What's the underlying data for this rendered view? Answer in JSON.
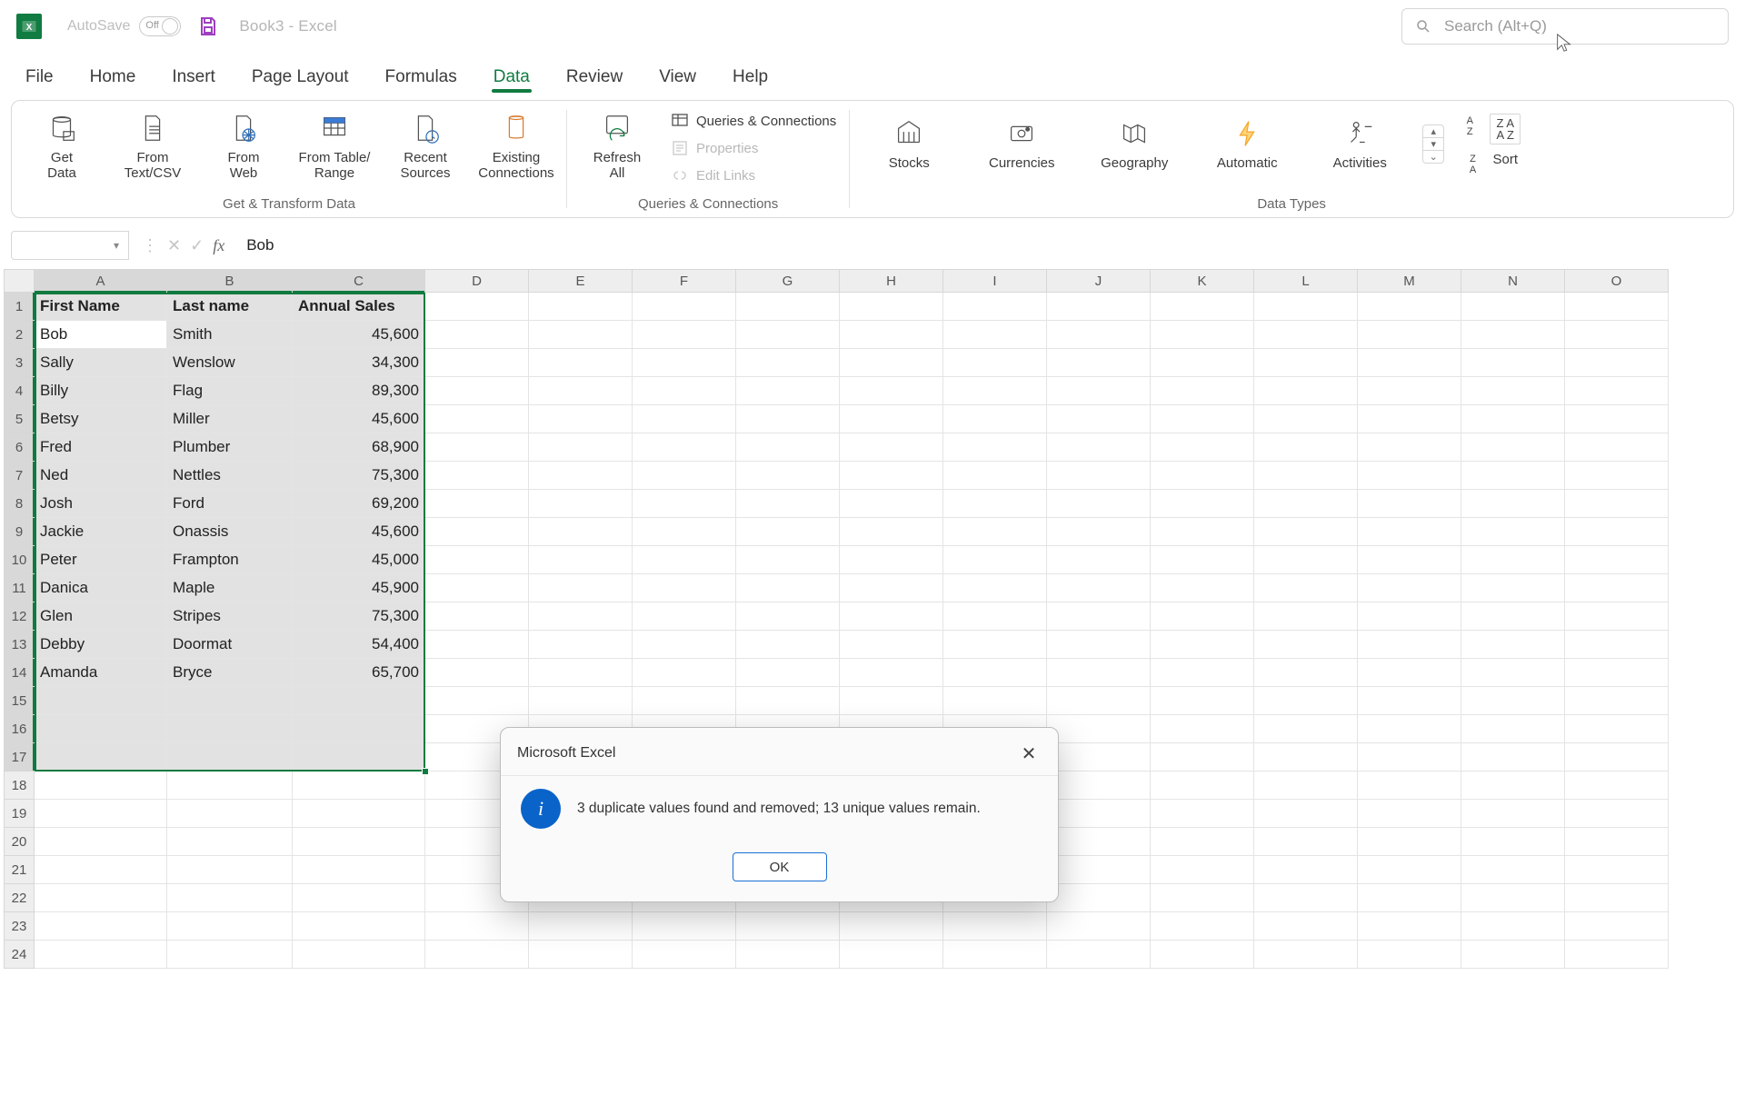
{
  "titlebar": {
    "autosave_label": "AutoSave",
    "autosave_state": "Off",
    "doc_title": "Book3  -  Excel",
    "search_placeholder": "Search (Alt+Q)"
  },
  "tabs": [
    "File",
    "Home",
    "Insert",
    "Page Layout",
    "Formulas",
    "Data",
    "Review",
    "View",
    "Help"
  ],
  "active_tab": "Data",
  "ribbon": {
    "group1": {
      "label": "Get & Transform Data",
      "buttons": [
        "Get\nData",
        "From\nText/CSV",
        "From\nWeb",
        "From Table/\nRange",
        "Recent\nSources",
        "Existing\nConnections"
      ]
    },
    "group2": {
      "label": "Queries & Connections",
      "refresh": "Refresh\nAll",
      "items": [
        "Queries & Connections",
        "Properties",
        "Edit Links"
      ]
    },
    "group3": {
      "label": "Data Types",
      "types": [
        "Stocks",
        "Currencies",
        "Geography",
        "Automatic",
        "Activities"
      ]
    },
    "group4": {
      "sort_label": "Sort"
    }
  },
  "namebox": "",
  "formula_value": "Bob",
  "columns": [
    "A",
    "B",
    "C",
    "D",
    "E",
    "F",
    "G",
    "H",
    "I",
    "J",
    "K",
    "L",
    "M",
    "N",
    "O"
  ],
  "sel_cols": [
    "A",
    "B",
    "C"
  ],
  "rows_count": 24,
  "sel_rows_from": 1,
  "sel_rows_to": 17,
  "table": {
    "headers": [
      "First Name",
      "Last name",
      "Annual Sales"
    ],
    "rows": [
      [
        "Bob",
        "Smith",
        "45,600"
      ],
      [
        "Sally",
        "Wenslow",
        "34,300"
      ],
      [
        "Billy",
        "Flag",
        "89,300"
      ],
      [
        "Betsy",
        "Miller",
        "45,600"
      ],
      [
        "Fred",
        "Plumber",
        "68,900"
      ],
      [
        "Ned",
        "Nettles",
        "75,300"
      ],
      [
        "Josh",
        "Ford",
        "69,200"
      ],
      [
        "Jackie",
        "Onassis",
        "45,600"
      ],
      [
        "Peter",
        "Frampton",
        "45,000"
      ],
      [
        "Danica",
        "Maple",
        "45,900"
      ],
      [
        "Glen",
        "Stripes",
        "75,300"
      ],
      [
        "Debby",
        "Doormat",
        "54,400"
      ],
      [
        "Amanda",
        "Bryce",
        "65,700"
      ]
    ]
  },
  "dialog": {
    "title": "Microsoft Excel",
    "message": "3 duplicate values found and removed; 13 unique values remain.",
    "ok": "OK"
  }
}
